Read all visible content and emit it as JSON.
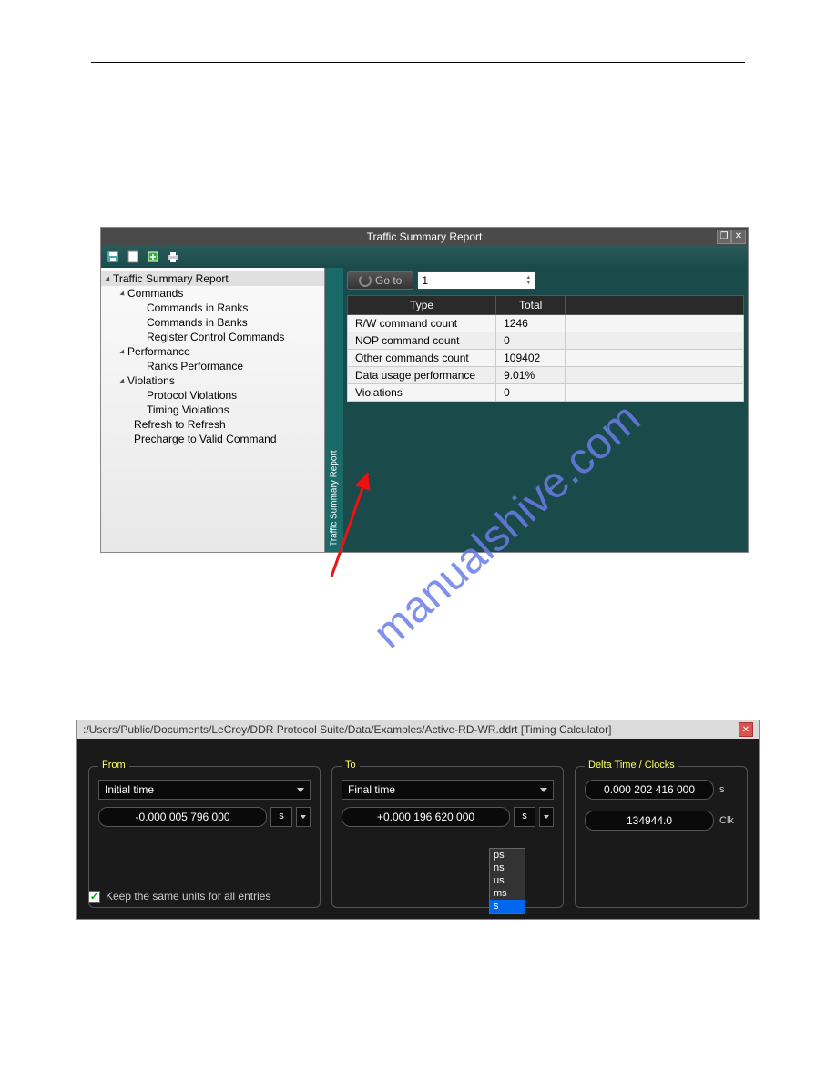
{
  "panel1": {
    "title": "Traffic Summary Report",
    "vtab_label": "Traffic Summary Report",
    "tree": {
      "root": "Traffic Summary Report",
      "commands": {
        "label": "Commands",
        "children": [
          "Commands in Ranks",
          "Commands in Banks",
          "Register Control Commands"
        ]
      },
      "performance": {
        "label": "Performance",
        "children": [
          "Ranks Performance"
        ]
      },
      "violations": {
        "label": "Violations",
        "children": [
          "Protocol Violations",
          "Timing Violations"
        ]
      },
      "refresh": "Refresh to Refresh",
      "precharge": "Precharge to Valid Command"
    },
    "goto_label": "Go to",
    "spin_value": "1",
    "table": {
      "headers": [
        "Type",
        "Total",
        ""
      ],
      "rows": [
        {
          "type": "R/W command count",
          "total": "1246"
        },
        {
          "type": "NOP command count",
          "total": "0"
        },
        {
          "type": "Other commands count",
          "total": "109402"
        },
        {
          "type": "Data usage performance",
          "total": "9.01%"
        },
        {
          "type": "Violations",
          "total": "0"
        }
      ]
    }
  },
  "watermark": "manualshive.com",
  "panel2": {
    "title": ":/Users/Public/Documents/LeCroy/DDR Protocol Suite/Data/Examples/Active-RD-WR.ddrt [Timing Calculator]",
    "from": {
      "legend": "From",
      "select": "Initial time",
      "value": "-0.000 005 796 000",
      "unit": "s"
    },
    "to": {
      "legend": "To",
      "select": "Final time",
      "value": "+0.000 196 620 000",
      "unit": "s"
    },
    "dd_options": [
      "ps",
      "ns",
      "us",
      "ms",
      "s"
    ],
    "dd_selected": "s",
    "delta": {
      "legend": "Delta Time / Clocks",
      "time": "0.000 202 416 000",
      "time_unit": "s",
      "clocks": "134944.0",
      "clocks_unit": "Clk"
    },
    "keep_units_label": "Keep the same units for all entries",
    "keep_units_checked": true
  }
}
